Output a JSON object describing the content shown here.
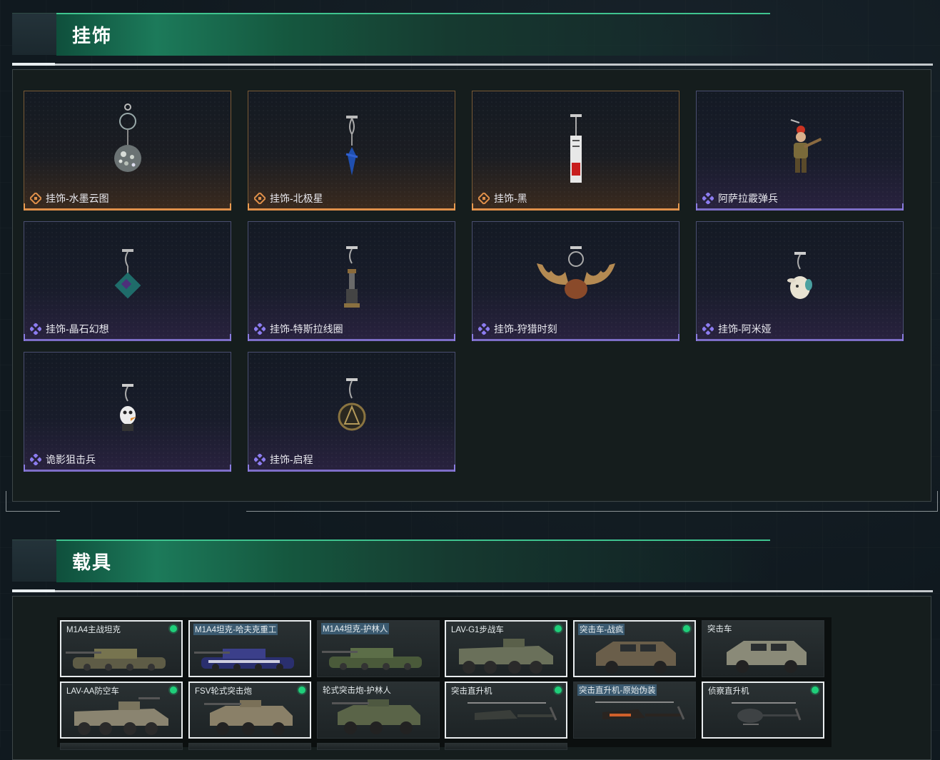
{
  "sections": {
    "pendants": {
      "title": "挂饰"
    },
    "vehicles": {
      "title": "载具"
    }
  },
  "pendants": [
    {
      "name": "挂饰-水墨云图",
      "rarity": "gold",
      "icon": "disco-ball-pendant-icon"
    },
    {
      "name": "挂饰-北极星",
      "rarity": "gold",
      "icon": "blue-star-pendant-icon"
    },
    {
      "name": "挂饰-黑",
      "rarity": "gold",
      "icon": "tag-pendant-icon"
    },
    {
      "name": "阿萨拉霰弹兵",
      "rarity": "purple",
      "icon": "soldier-figure-pendant-icon"
    },
    {
      "name": "挂饰-晶石幻想",
      "rarity": "purple",
      "icon": "crystal-cube-pendant-icon"
    },
    {
      "name": "挂饰-特斯拉线圈",
      "rarity": "purple",
      "icon": "tesla-coil-pendant-icon"
    },
    {
      "name": "挂饰-狩猎时刻",
      "rarity": "purple",
      "icon": "moose-antler-pendant-icon"
    },
    {
      "name": "挂饰-阿米娅",
      "rarity": "purple",
      "icon": "bunny-pendant-icon"
    },
    {
      "name": "诡影狙击兵",
      "rarity": "purple",
      "icon": "white-mask-pendant-icon"
    },
    {
      "name": "挂饰-启程",
      "rarity": "purple",
      "icon": "medal-pendant-icon"
    }
  ],
  "vehicles": [
    {
      "name": "M1A4主战坦克",
      "selected": true,
      "owned": true,
      "highlight": false,
      "icon": "tank-icon"
    },
    {
      "name": "M1A4坦克-哈夫克重工",
      "selected": true,
      "owned": false,
      "highlight": true,
      "icon": "tank-icon"
    },
    {
      "name": "M1A4坦克-护林人",
      "selected": false,
      "owned": false,
      "highlight": true,
      "icon": "tank-icon"
    },
    {
      "name": "LAV-G1步战车",
      "selected": true,
      "owned": true,
      "highlight": false,
      "icon": "ifv-icon"
    },
    {
      "name": "突击车-战疯",
      "selected": true,
      "owned": true,
      "highlight": true,
      "icon": "assault-car-icon"
    },
    {
      "name": "突击车",
      "selected": false,
      "owned": false,
      "highlight": false,
      "icon": "assault-car-icon"
    },
    {
      "name": "LAV-AA防空车",
      "selected": true,
      "owned": true,
      "highlight": false,
      "icon": "aa-vehicle-icon"
    },
    {
      "name": "FSV轮式突击炮",
      "selected": true,
      "owned": true,
      "highlight": false,
      "icon": "wheeled-gun-icon"
    },
    {
      "name": "轮式突击炮-护林人",
      "selected": false,
      "owned": false,
      "highlight": false,
      "icon": "wheeled-gun-icon"
    },
    {
      "name": "突击直升机",
      "selected": true,
      "owned": true,
      "highlight": false,
      "icon": "attack-helicopter-icon"
    },
    {
      "name": "突击直升机-原始伪装",
      "selected": false,
      "owned": false,
      "highlight": true,
      "icon": "attack-helicopter-icon"
    },
    {
      "name": "侦察直升机",
      "selected": true,
      "owned": true,
      "highlight": false,
      "icon": "scout-helicopter-icon"
    }
  ],
  "colors": {
    "accent_green": "#1fcf7a",
    "rarity_gold": "#e0904a",
    "rarity_purple": "#7d6ec7"
  }
}
